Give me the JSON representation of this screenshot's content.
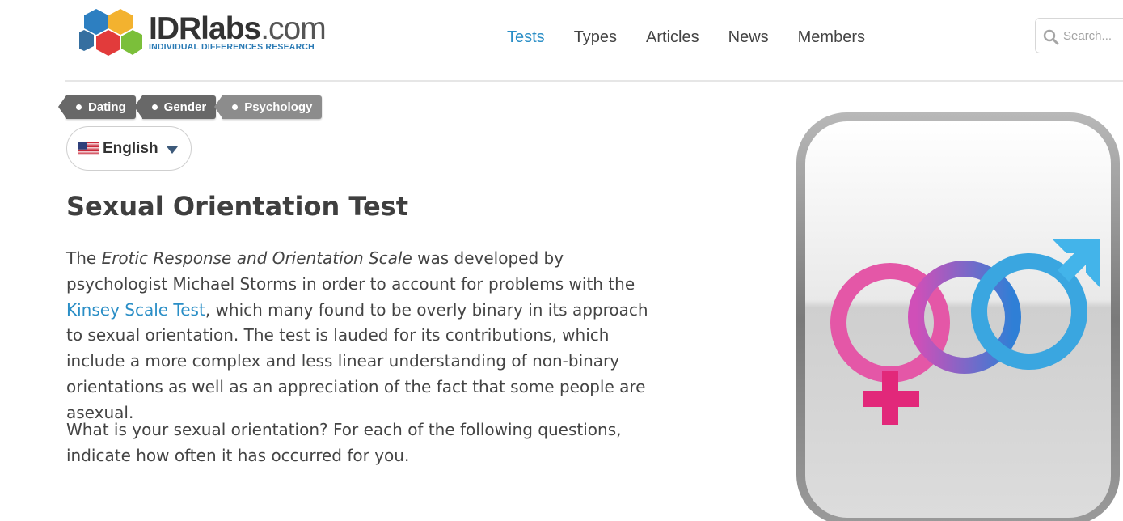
{
  "brand": {
    "name_bold": "IDRlabs",
    "name_light": ".com",
    "tagline": "INDIVIDUAL DIFFERENCES RESEARCH"
  },
  "nav": {
    "items": [
      {
        "label": "Tests",
        "active": true
      },
      {
        "label": "Types",
        "active": false
      },
      {
        "label": "Articles",
        "active": false
      },
      {
        "label": "News",
        "active": false
      },
      {
        "label": "Members",
        "active": false
      }
    ]
  },
  "search": {
    "placeholder": "Search..."
  },
  "tags": [
    {
      "label": "Dating"
    },
    {
      "label": "Gender"
    },
    {
      "label": "Psychology"
    }
  ],
  "language": {
    "selected": "English"
  },
  "article": {
    "title": "Sexual Orientation Test",
    "p1_before": "The ",
    "p1_italic": "Erotic Response and Orientation Scale",
    "p1_mid": " was developed by psychologist Michael Storms in order to account for problems with the ",
    "p1_link": "Kinsey Scale Test",
    "p1_after": ", which many found to be overly binary in its approach to sexual orientation. The test is lauded for its contributions, which include a more complex and less linear understanding of non-binary orientations as well as an appreciation of the fact that some people are asexual.",
    "p2": "What is your sexual orientation? For each of the following questions, indicate how often it has occurred for you."
  },
  "colors": {
    "accent": "#2a8ec6",
    "tag_dark": "#686868",
    "tag_light": "#8c8c8c",
    "female_pink": "#e83e8c",
    "male_blue": "#3aa6e0"
  },
  "icons": {
    "logo": "hexagon-cluster-logo",
    "search": "search-icon",
    "flag": "us-flag-icon",
    "caret": "caret-down-icon",
    "hero": "interlocked-gender-symbols-icon"
  }
}
